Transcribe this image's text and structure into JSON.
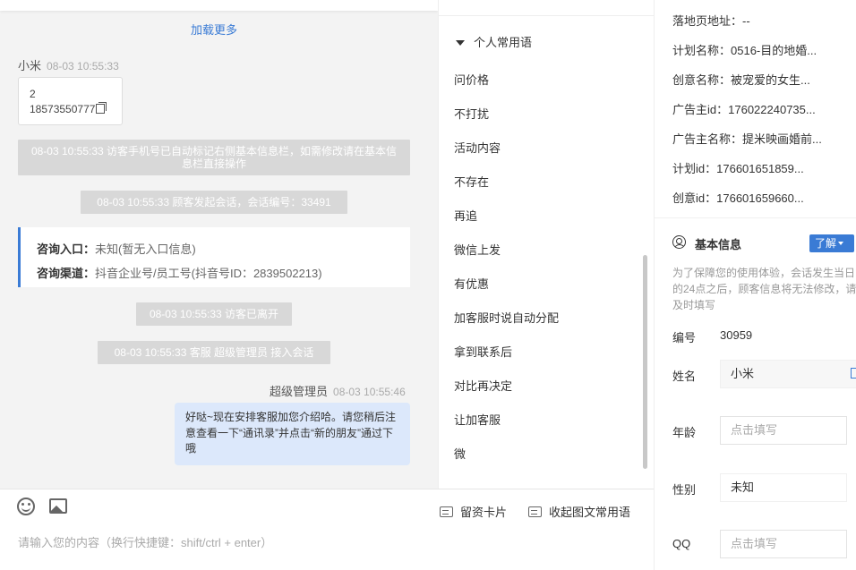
{
  "chat": {
    "load_more": "加载更多",
    "visitor": {
      "name": "小米",
      "time": "08-03 10:55:33"
    },
    "card": {
      "line1": "2",
      "line2": "18573550777"
    },
    "system_messages": [
      "08-03 10:55:33 访客手机号已自动标记右侧基本信息栏，如需修改请在基本信息栏直接操作",
      "08-03 10:55:33 顾客发起会话，会话编号：33491",
      "08-03 10:55:33 访客已离开",
      "08-03 10:55:33 客服 超级管理员 接入会话"
    ],
    "entry": {
      "label1": "咨询入口：",
      "value1": "未知(暂无入口信息)",
      "label2": "咨询渠道：",
      "value2": "抖音企业号/员工号(抖音号ID：2839502213)"
    },
    "agent": {
      "name": "超级管理员",
      "time": "08-03 10:55:46"
    },
    "agent_message": "好哒~现在安排客服加您介绍哈。请您稍后注意查看一下“通讯录”并点击“新的朋友”通过下哦"
  },
  "input": {
    "placeholder": "请输入您的内容（换行快捷键：shift/ctrl + enter）",
    "card_button": "留资卡片",
    "collapse_button": "收起图文常用语"
  },
  "phrases": {
    "header": "个人常用语",
    "items": [
      "问价格",
      "不打扰",
      "活动内容",
      "不存在",
      "再追",
      "微信上发",
      "有优惠",
      "加客服时说自动分配",
      "拿到联系后",
      "对比再决定",
      "让加客服",
      "微"
    ]
  },
  "info": {
    "rows": [
      {
        "label": "落地页地址：",
        "value": "--"
      },
      {
        "label": "计划名称：",
        "value": "0516-目的地婚..."
      },
      {
        "label": "创意名称：",
        "value": "被宠爱的女生..."
      },
      {
        "label": "广告主id：",
        "value": "176022240735..."
      },
      {
        "label": "广告主名称：",
        "value": "提米映画婚前..."
      },
      {
        "label": "计划id：",
        "value": "176601651859..."
      },
      {
        "label": "创意id：",
        "value": "176601659660..."
      }
    ],
    "section_title": "基本信息",
    "learn_more": "了解",
    "notice": "为了保障您的使用体验，会话发生当日的24点之后，顾客信息将无法修改，请及时填写",
    "fields": {
      "id_label": "编号",
      "id_value": "30959",
      "name_label": "姓名",
      "name_value": "小米",
      "age_label": "年龄",
      "age_placeholder": "点击填写",
      "gender_label": "性别",
      "gender_value": "未知",
      "qq_label": "QQ",
      "qq_placeholder": "点击填写"
    }
  }
}
